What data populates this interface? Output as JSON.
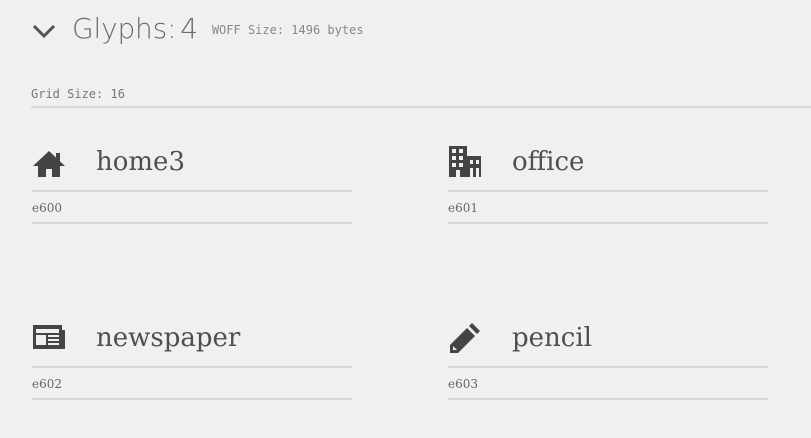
{
  "header": {
    "collapse_icon": "chevron-down-icon",
    "title_label": "Glyphs:",
    "glyph_count": "4",
    "woff_size": "WOFF Size: 1496 bytes"
  },
  "grid": {
    "size_label": "Grid Size: 16"
  },
  "glyphs": [
    {
      "name": "home3",
      "code": "e600",
      "icon": "home-icon"
    },
    {
      "name": "office",
      "code": "e601",
      "icon": "office-building-icon"
    },
    {
      "name": "newspaper",
      "code": "e602",
      "icon": "newspaper-icon"
    },
    {
      "name": "pencil",
      "code": "e603",
      "icon": "pencil-icon"
    }
  ],
  "colors": {
    "background": "#f0f0f0",
    "icon": "#444444",
    "divider": "#d9d9d9"
  }
}
